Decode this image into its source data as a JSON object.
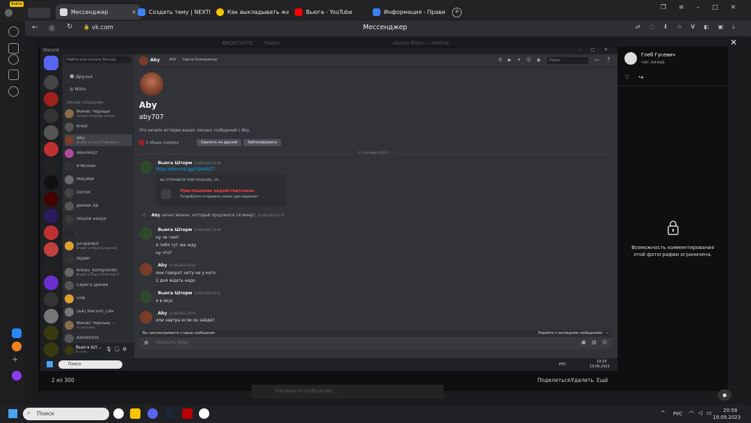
{
  "browser": {
    "tabs": [
      {
        "label": "Мессенджер",
        "color": "#2f2f33"
      },
      {
        "label": "Создать тему | NEXTRP",
        "color": "#3b82f6"
      },
      {
        "label": "Как выкладывать жалобу",
        "color": "#f5c400"
      },
      {
        "label": "Вьюга - YouTube",
        "color": "#ff0000"
      },
      {
        "label": "Информация - Правила п",
        "color": "#3b82f6"
      }
    ],
    "address": "vk.com",
    "page_title": "Мессенджер",
    "badge": "Бэйта"
  },
  "discord": {
    "app_name": "Discord",
    "search_placeholder": "Найти или начать беседу",
    "nav": [
      "Друзья",
      "Nitro"
    ],
    "dm_header": "ЛИЧНЫЕ СООБЩЕНИЯ",
    "dms": [
      {
        "name": "Финис Черный",
        "sub": "смотрит впереди начала",
        "color": "#8a6b4a"
      },
      {
        "name": "Krest",
        "sub": "",
        "color": "#555"
      },
      {
        "name": "Aby",
        "sub": "Играет в Grand Theft Auto S...",
        "color": "#7a3b2a"
      },
      {
        "name": "waureeyz",
        "sub": "",
        "color": "#b04aa0"
      },
      {
        "name": "втвсный",
        "sub": "",
        "color": "#333"
      },
      {
        "name": "MADINA",
        "sub": "",
        "color": "#6a6a6a"
      },
      {
        "name": "zxchot",
        "sub": "",
        "color": "#444"
      },
      {
        "name": "Дикий Эд",
        "sub": "",
        "color": "#555"
      },
      {
        "name": "пошли нахуй",
        "sub": "",
        "color": "#3a3a3a"
      },
      {
        "name": "-",
        "sub": "",
        "color": "#2a2a2a"
      },
      {
        "name": "JuniperBot",
        "sub": "Играет в https://juniper.bot",
        "color": "#e0a030"
      },
      {
        "name": "dipper",
        "sub": "",
        "color": "#333"
      },
      {
        "name": "Arelav_Komprendo",
        "sub": "Играет в Grand Theft Auto S...",
        "color": "#666"
      },
      {
        "name": "Серега Дикий",
        "sub": "",
        "color": "#555"
      },
      {
        "name": "volk",
        "sub": "",
        "color": "#e0a030"
      },
      {
        "name": "[БА] Macsim_Lite",
        "sub": "",
        "color": "#777"
      },
      {
        "name": "Финис Черный, -",
        "sub": "3 участника",
        "color": "#8a6b4a"
      },
      {
        "name": "AxhelXIOS",
        "sub": "",
        "color": "#555"
      }
    ],
    "user_panel": {
      "name": "Вьюга Шт...",
      "status": "В сети"
    },
    "header": {
      "name": "Aby",
      "tag": "AKA",
      "nick": "Чарли Комприндо",
      "search": "Поиск"
    },
    "profile": {
      "display": "Aby",
      "username": "aby707",
      "intro": "Это начало истории ваших личных сообщений с Aby.",
      "mutual": "2 общих сервера",
      "remove": "Удалить из друзей",
      "block": "Заблокировать"
    },
    "date_divider": "11 сентября 2023 г.",
    "messages": [
      {
        "author": "Вьюга Шторм",
        "time": "11.09.2023 22:24",
        "lines": [
          "https://discord.gg/FjQdARZ7"
        ]
      },
      {
        "author": "Вьюга Шторм",
        "time": "11.09.2023 23:45",
        "lines": [
          "ну че там?",
          "я тебя тут же жду",
          "ну что?"
        ]
      },
      {
        "author": "Aby",
        "time": "11.09.2023 22:51",
        "lines": [
          "они говорят нету не у кого",
          "2 дня ждать надо"
        ]
      },
      {
        "author": "Вьюга Шторм",
        "time": "11.09.2023 22:51",
        "lines": [
          "я в акус"
        ]
      },
      {
        "author": "Aby",
        "time": "11.09.2023 22:51",
        "lines": [
          "или завтра если он зайдёт"
        ]
      }
    ],
    "invite": {
      "title": "ВЫ ОТПРАВИЛИ ПРИГЛАШЕНИЕ, НО...",
      "invalid": "Приглашение недействительно",
      "hint": "Попробуйте отправить новое приглашение!"
    },
    "call": {
      "author": "Aby",
      "text": "начал звонок, который продлился 14 минут.",
      "time": "11.09.2023 22:37"
    },
    "old_bar": {
      "left": "Вы просматриваете старые сообщения",
      "right": "Перейти к последним сообщениям"
    },
    "composer_placeholder": "Написать @Aby",
    "inner_taskbar": {
      "search": "Поиск",
      "lang": "РУС",
      "time": "19:33",
      "date": "19.09.2023"
    }
  },
  "viewer": {
    "counter": "2 из 300",
    "share": "Поделиться",
    "delete": "Удалить",
    "more": "Ещё"
  },
  "comments": {
    "author": "Глеб Гусевич",
    "time": "час назад",
    "locked": "Возможность комментирования этой фотографии ограничена."
  },
  "vk_behind": {
    "logo": "ВКОНТАКТЕ",
    "search": "Поиск",
    "now_playing": "Abusin Plays — mellow",
    "compose": "Напишите сообщение..."
  },
  "taskbar": {
    "search": "Поиск",
    "lang": "РУС",
    "time": "20:58",
    "date": "19.09.2023"
  }
}
